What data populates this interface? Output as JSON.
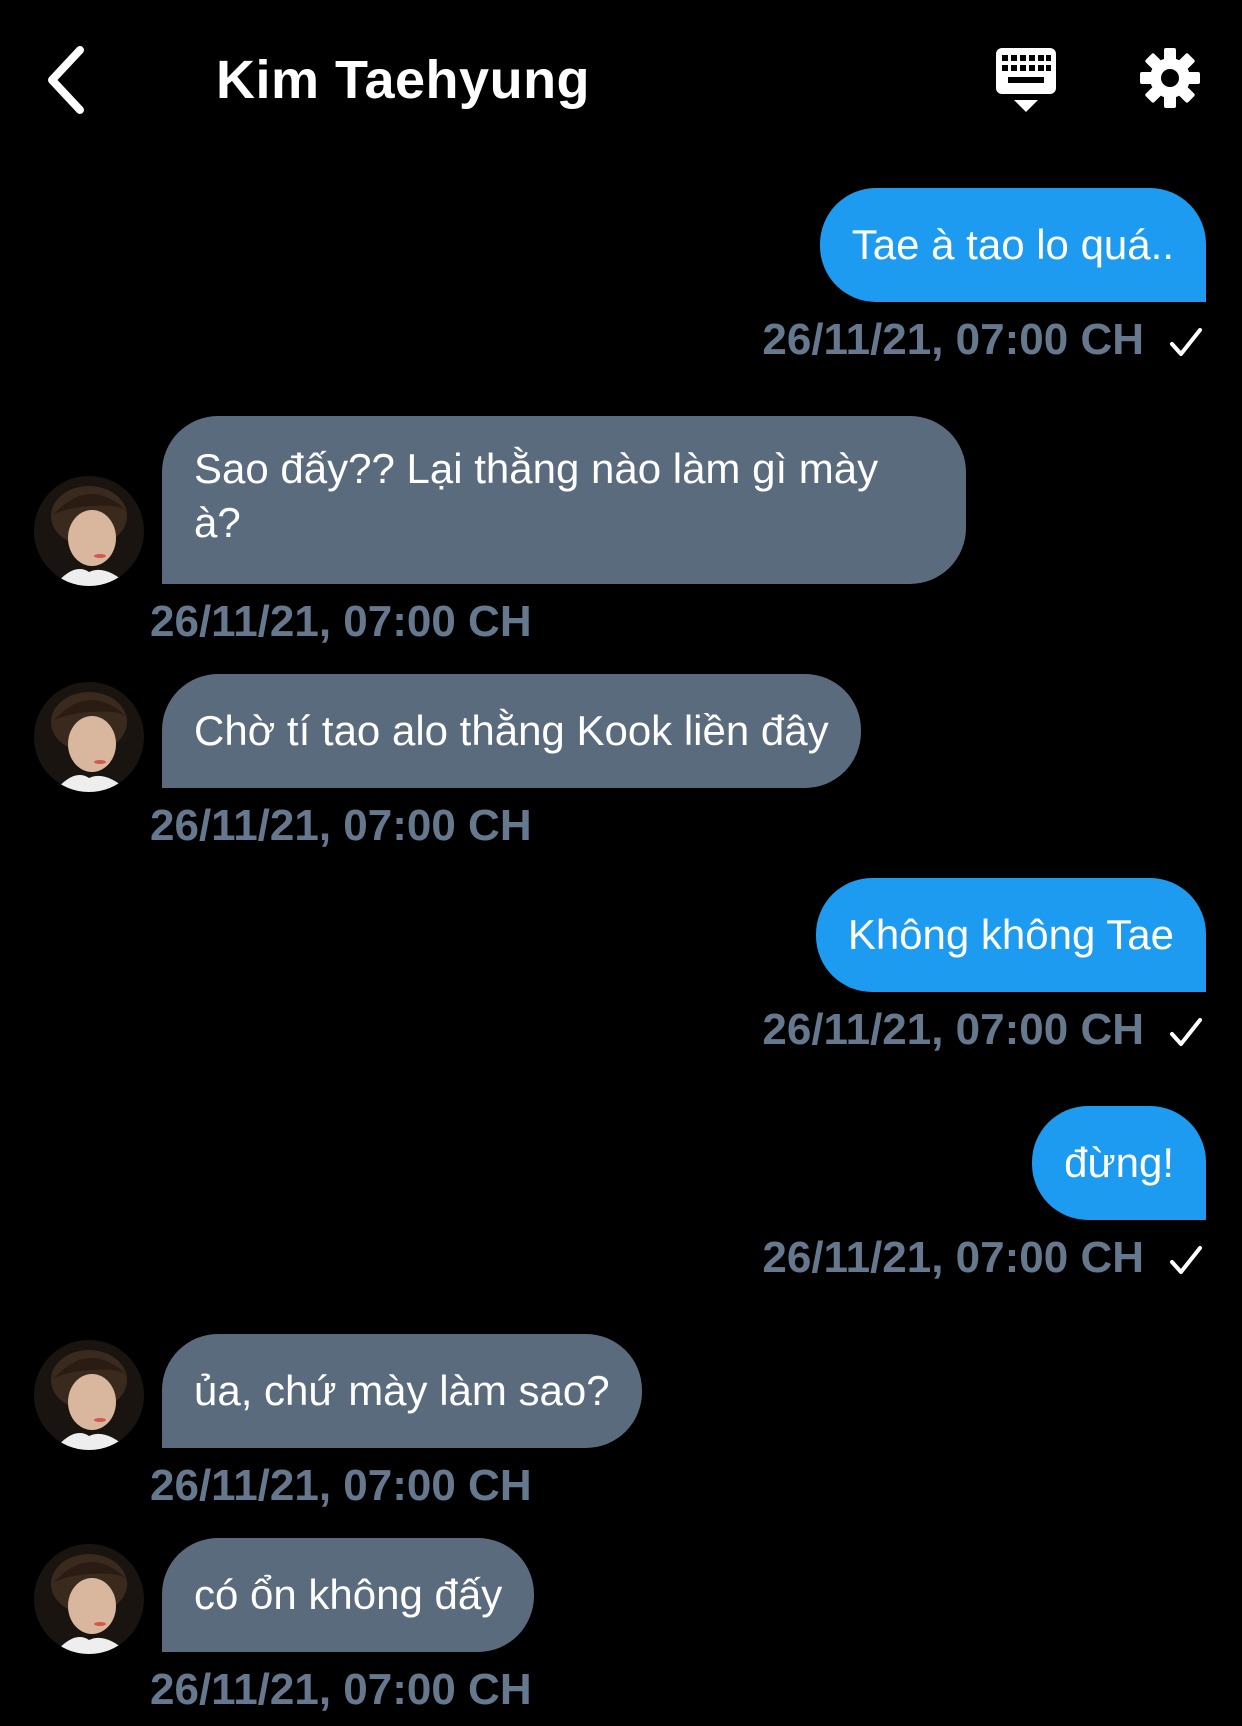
{
  "header": {
    "title": "Kim Taehyung",
    "back_icon": "chevron-left-icon",
    "keyboard_icon": "keyboard-icon",
    "settings_icon": "gear-icon"
  },
  "colors": {
    "background": "#000000",
    "sent_bubble": "#1d9bf0",
    "received_bubble": "#5b6b7e",
    "timestamp": "#66788d"
  },
  "messages": [
    {
      "direction": "sent",
      "text": "Tae à tao lo quá..",
      "time": "26/11/21, 07:00 CH",
      "read": true
    },
    {
      "direction": "received",
      "text": "Sao đấy?? Lại thằng nào làm gì mày à?",
      "time": "26/11/21, 07:00 CH"
    },
    {
      "direction": "received",
      "text": "Chờ tí tao alo thằng Kook liền đây",
      "time": "26/11/21, 07:00 CH"
    },
    {
      "direction": "sent",
      "text": "Không không Tae",
      "time": "26/11/21, 07:00 CH",
      "read": true
    },
    {
      "direction": "sent",
      "text": "đừng!",
      "time": "26/11/21, 07:00 CH",
      "read": true
    },
    {
      "direction": "received",
      "text": "ủa, chứ mày làm sao?",
      "time": "26/11/21, 07:00 CH"
    },
    {
      "direction": "received",
      "text": "có ổn không đấy",
      "time": "26/11/21, 07:00 CH"
    }
  ]
}
